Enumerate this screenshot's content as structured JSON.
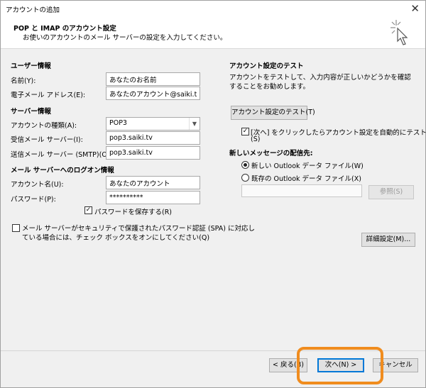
{
  "window": {
    "title": "アカウントの追加",
    "close_label": "✕"
  },
  "header": {
    "title": "POP と IMAP のアカウント設定",
    "subtitle": "お使いのアカウントのメール サーバーの設定を入力してください。",
    "icon": "cursor-sparkle-icon"
  },
  "left": {
    "user_info": {
      "heading": "ユーザー情報",
      "name_label": "名前(Y):",
      "name_value": "あなたのお名前",
      "email_label": "電子メール アドレス(E):",
      "email_value": "あなたのアカウント@saiki.tv"
    },
    "server_info": {
      "heading": "サーバー情報",
      "account_type_label": "アカウントの種類(A):",
      "account_type_value": "POP3",
      "incoming_label": "受信メール サーバー(I):",
      "incoming_value": "pop3.saiki.tv",
      "outgoing_label": "送信メール サーバー (SMTP)(O):",
      "outgoing_value": "pop3.saiki.tv"
    },
    "logon_info": {
      "heading": "メール サーバーへのログオン情報",
      "account_name_label": "アカウント名(U):",
      "account_name_value": "あなたのアカウント",
      "password_label": "パスワード(P):",
      "password_value": "**********",
      "save_password_label": "パスワードを保存する(R)",
      "save_password_checked": true,
      "spa_label_line1": "メール サーバーがセキュリティで保護されたパスワード認証 (SPA) に対応し",
      "spa_label_line2": "ている場合には、チェック ボックスをオンにしてください(Q)",
      "spa_checked": false
    }
  },
  "right": {
    "test": {
      "heading": "アカウント設定のテスト",
      "description": "アカウントをテストして、入力内容が正しいかどうかを確認することをお勧めします。",
      "test_button": "アカウント設定のテスト(T)",
      "auto_test_label_line1": "[次へ] をクリックしたらアカウント設定を自動的にテストする",
      "auto_test_label_line2": "(S)",
      "auto_test_checked": true
    },
    "delivery": {
      "heading": "新しいメッセージの配信先:",
      "new_file_label": "新しい Outlook データ ファイル(W)",
      "existing_file_label": "既存の Outlook データ ファイル(X)",
      "selected": "new",
      "browse_button": "参照(S)"
    },
    "more_settings_button": "詳細設定(M)..."
  },
  "footer": {
    "back_button": "< 戻る(B)",
    "next_button": "次へ(N) >",
    "cancel_button": "キャンセル",
    "highlight_color": "#f08c1e"
  }
}
